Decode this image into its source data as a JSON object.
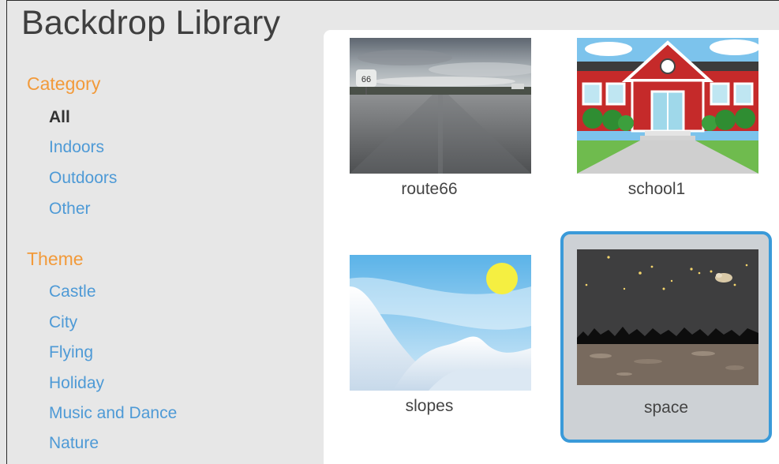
{
  "title": "Backdrop Library",
  "sidebar": {
    "category_heading": "Category",
    "categories": [
      "All",
      "Indoors",
      "Outdoors",
      "Other"
    ],
    "selected_category": "All",
    "theme_heading": "Theme",
    "themes": [
      "Castle",
      "City",
      "Flying",
      "Holiday",
      "Music and Dance",
      "Nature"
    ]
  },
  "backdrops": [
    {
      "name": "route66"
    },
    {
      "name": "school1"
    },
    {
      "name": "slopes"
    },
    {
      "name": "space",
      "selected": true
    }
  ],
  "colors": {
    "heading": "#f29a3a",
    "link": "#4e9ad6",
    "selection_border": "#3a9ad9"
  }
}
